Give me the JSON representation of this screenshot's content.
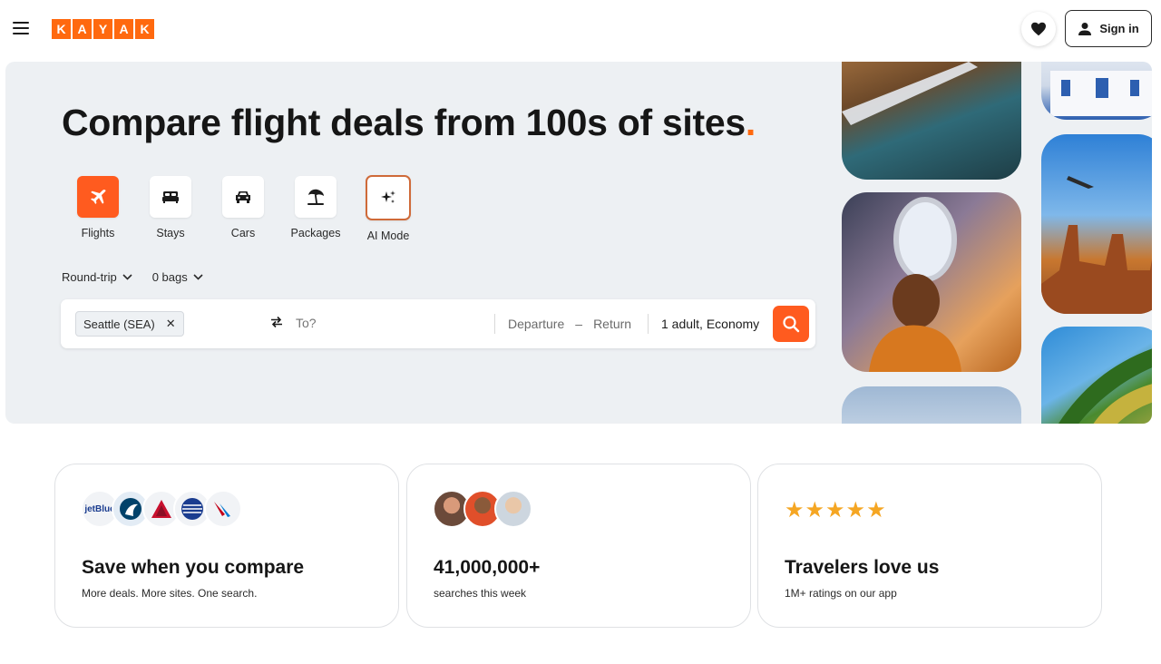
{
  "header": {
    "logo_letters": [
      "K",
      "A",
      "Y",
      "A",
      "K"
    ],
    "signin_label": "Sign in"
  },
  "hero": {
    "title": "Compare flight deals from 100s of sites",
    "title_dot": ".",
    "tabs": [
      {
        "label": "Flights",
        "icon": "plane-icon",
        "active": true
      },
      {
        "label": "Stays",
        "icon": "bed-icon"
      },
      {
        "label": "Cars",
        "icon": "car-icon"
      },
      {
        "label": "Packages",
        "icon": "beach-umbrella-icon"
      },
      {
        "label": "AI Mode",
        "icon": "sparkle-icon"
      }
    ],
    "trip_type": "Round-trip",
    "bags": "0 bags"
  },
  "search": {
    "origin": "Seattle (SEA)",
    "destination_placeholder": "To?",
    "departure": "Departure",
    "date_separator": "–",
    "return": "Return",
    "travelers": "1 adult, Economy"
  },
  "cards": [
    {
      "title": "Save when you compare",
      "subtitle": "More deals. More sites. One search.",
      "airlines": [
        "jetBlue",
        "Alaska",
        "Delta",
        "United",
        "American"
      ]
    },
    {
      "title": "41,000,000+",
      "subtitle": "searches this week"
    },
    {
      "title": "Travelers love us",
      "subtitle": "1M+ ratings on our app",
      "rating_stars": 5
    }
  ],
  "colors": {
    "brand": "#ff690f",
    "accent": "#ff5b1f",
    "hero_bg": "#edf0f3",
    "star": "#f5a623"
  }
}
